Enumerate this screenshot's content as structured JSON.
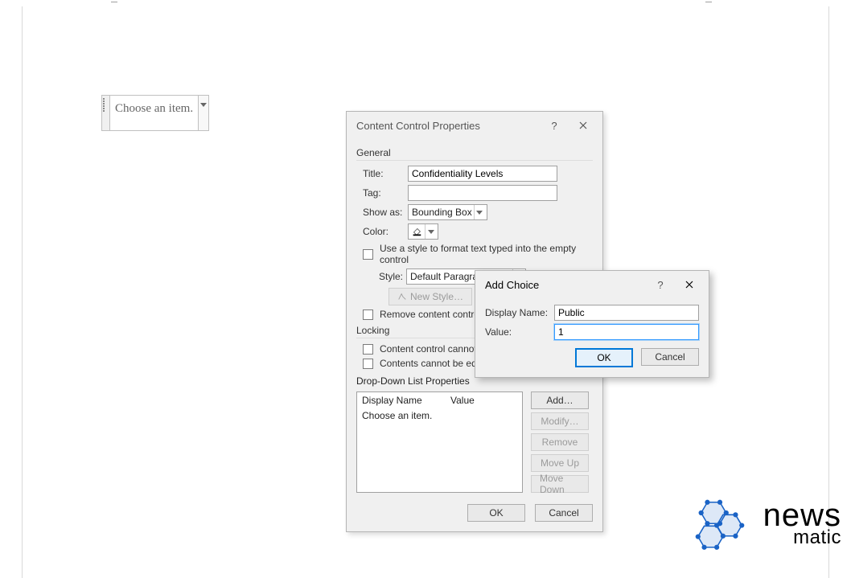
{
  "page": {
    "combo_placeholder": "Choose an item."
  },
  "dialog_props": {
    "title": "Content Control Properties",
    "section_general": "General",
    "title_label": "Title:",
    "title_value": "Confidentiality Levels",
    "tag_label": "Tag:",
    "tag_value": "",
    "showas_label": "Show as:",
    "showas_value": "Bounding Box",
    "color_label": "Color:",
    "use_style_label": "Use a style to format text typed into the empty control",
    "style_label": "Style:",
    "style_value": "Default Paragraph Font",
    "new_style_label": "New Style…",
    "remove_label": "Remove content control when contents are edited",
    "section_locking": "Locking",
    "lock_delete_label": "Content control cannot be deleted",
    "lock_edit_label": "Contents cannot be edited",
    "list_props_label": "Drop-Down List Properties",
    "list_col_name": "Display Name",
    "list_col_value": "Value",
    "list_item0_name": "Choose an item.",
    "btn_add": "Add…",
    "btn_modify": "Modify…",
    "btn_remove": "Remove",
    "btn_moveup": "Move Up",
    "btn_movedown": "Move Down",
    "btn_ok": "OK",
    "btn_cancel": "Cancel"
  },
  "dialog_add": {
    "title": "Add Choice",
    "display_name_label": "Display Name:",
    "display_name_value": "Public",
    "value_label": "Value:",
    "value_value": "1",
    "btn_ok": "OK",
    "btn_cancel": "Cancel"
  },
  "logo": {
    "line1": "news",
    "line2": "matic"
  }
}
